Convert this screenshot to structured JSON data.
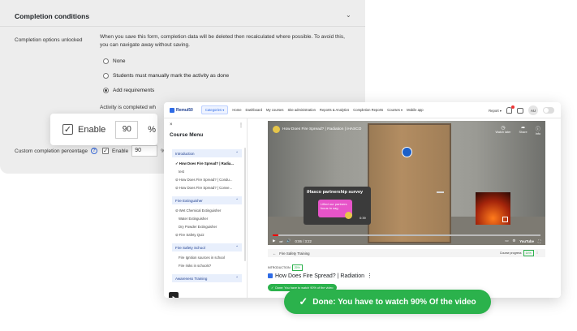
{
  "settings": {
    "header": "Completion conditions",
    "unlocked_label": "Completion options unlocked",
    "unlocked_desc": "When you save this form, completion data will be deleted then recalculated where possible. To avoid this, you can navigate away without saving.",
    "options": [
      "None",
      "Students must manually mark the activity as done",
      "Add requirements"
    ],
    "selected_option": "Add requirements",
    "activity_completed": "Activity is completed wh",
    "custom_label": "Custom completion percentage",
    "enable_label": "Enable",
    "percent_value": "90",
    "percent_unit": "%"
  },
  "callout": {
    "enable_label": "Enable",
    "value": "90",
    "unit": "%"
  },
  "nav": {
    "brand": "Remui50",
    "categories": "Categories ▾",
    "items": [
      "Home",
      "Dashboard",
      "My courses",
      "Site administration",
      "Reports & Analytics",
      "Completion Reports",
      "Courses ▾",
      "Mobile app"
    ],
    "report": "Report ▾",
    "avatar": "AU"
  },
  "sidebar": {
    "close": "×",
    "kebab": "⋮",
    "title": "Course Menu",
    "sections": [
      {
        "name": "Introduction",
        "items": [
          "✓ How Does Fire Spread? | Radia...",
          "test",
          "⊘ How Does Fire Spread? | Condu...",
          "⊘ How Does Fire Spread? | Conve..."
        ]
      },
      {
        "name": "Fire Extinguisher",
        "items": [
          "⊘ Wet Chemical Extinguisher",
          "Water Extinguisher",
          "Dry Powder Extinguisher",
          "⊘ Fire Safety Quiz"
        ]
      },
      {
        "name": "Fire Safety School",
        "items": [
          "Fire Ignition sources in school",
          "Fire risks in schools?"
        ]
      },
      {
        "name": "Awareness Training",
        "items": []
      }
    ]
  },
  "video": {
    "title": "How Does Fire Spread? | Radiation | iHASCO",
    "watch_later": "Watch later",
    "share": "Share",
    "info": "Info",
    "survey_title": "iHasco partnership survey",
    "survey_bubble": "Lifted our partners focus to sag",
    "survey_time": "0:39",
    "time": "0:06 / 3:22",
    "youtube": "YouTube",
    "progress_pct": 2
  },
  "lesson": {
    "breadcrumb": "Fire Safety Training",
    "course_progress_label": "Course progress",
    "course_progress_value": "14%",
    "section_label": "INTRODUCTION",
    "section_pct": "25%",
    "title": "How Does Fire Spread? | Radiation",
    "done_small": "Done: You have to watch 90% of the video"
  },
  "done_badge": "Done: You have to watch 90% Of the video"
}
